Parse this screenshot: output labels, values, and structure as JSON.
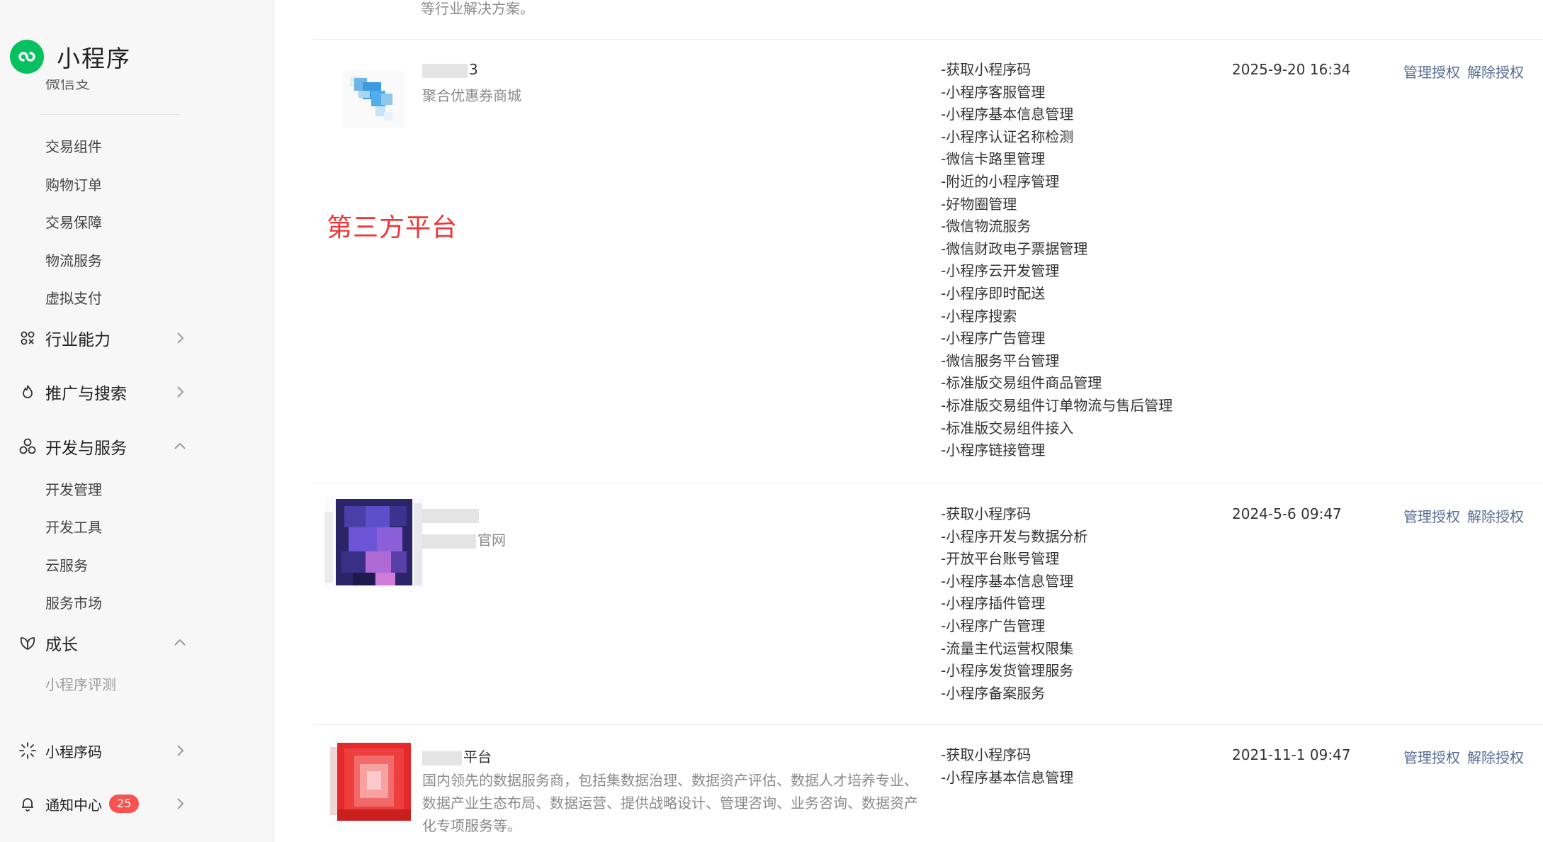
{
  "sidebar": {
    "logo_text": "小程序",
    "clipped_item": "微信支付",
    "sub_items_trade": [
      "交易组件",
      "购物订单",
      "交易保障",
      "物流服务",
      "虚拟支付"
    ],
    "group_industry": "行业能力",
    "group_promote": "推广与搜索",
    "group_dev": "开发与服务",
    "sub_items_dev": [
      "开发管理",
      "开发工具",
      "云服务",
      "服务市场"
    ],
    "group_growth": "成长",
    "sub_items_growth": [
      "小程序评测"
    ],
    "qrcode": "小程序码",
    "notify": "通知中心",
    "notify_count": "25"
  },
  "main": {
    "clipped_top_text": "等行业解决方案。",
    "annotation": "第三方平台",
    "rows": [
      {
        "name_suffix": "3",
        "desc": "聚合优惠券商城",
        "permissions": [
          "-获取小程序码",
          "-小程序客服管理",
          "-小程序基本信息管理",
          "-小程序认证名称检测",
          "-微信卡路里管理",
          "-附近的小程序管理",
          "-好物圈管理",
          "-微信物流服务",
          "-微信财政电子票据管理",
          "-小程序云开发管理",
          "-小程序即时配送",
          "-小程序搜索",
          "-小程序广告管理",
          "-微信服务平台管理",
          "-标准版交易组件商品管理",
          "-标准版交易组件订单物流与售后管理",
          "-标准版交易组件接入",
          "-小程序链接管理"
        ],
        "time": "2025-9-20 16:34",
        "manage": "管理授权",
        "revoke": "解除授权"
      },
      {
        "name_suffix": "",
        "desc": "官网",
        "permissions": [
          "-获取小程序码",
          "-小程序开发与数据分析",
          "-开放平台账号管理",
          "-小程序基本信息管理",
          "-小程序插件管理",
          "-小程序广告管理",
          "-流量主代运营权限集",
          "-小程序发货管理服务",
          "-小程序备案服务"
        ],
        "time": "2024-5-6 09:47",
        "manage": "管理授权",
        "revoke": "解除授权"
      },
      {
        "name_suffix": "平台",
        "desc": "国内领先的数据服务商，包括集数据治理、数据资产评估、数据人才培养专业、数据产业生态布局、数据运营、提供战略设计、管理咨询、业务咨询、数据资产化专项服务等。",
        "permissions": [
          "-获取小程序码",
          "-小程序基本信息管理"
        ],
        "time": "2021-11-1 09:47",
        "manage": "管理授权",
        "revoke": "解除授权"
      }
    ]
  },
  "colors": {
    "brand_green": "#07c160",
    "link": "#576b95",
    "badge_red": "#fa5151",
    "annotation_red": "#ee3535"
  },
  "icons": [
    "miniprogram-logo-icon",
    "industry-icon",
    "promote-icon",
    "dev-service-icon",
    "growth-icon",
    "qrcode-icon",
    "bell-icon",
    "chevron-right-icon",
    "chevron-up-icon"
  ]
}
